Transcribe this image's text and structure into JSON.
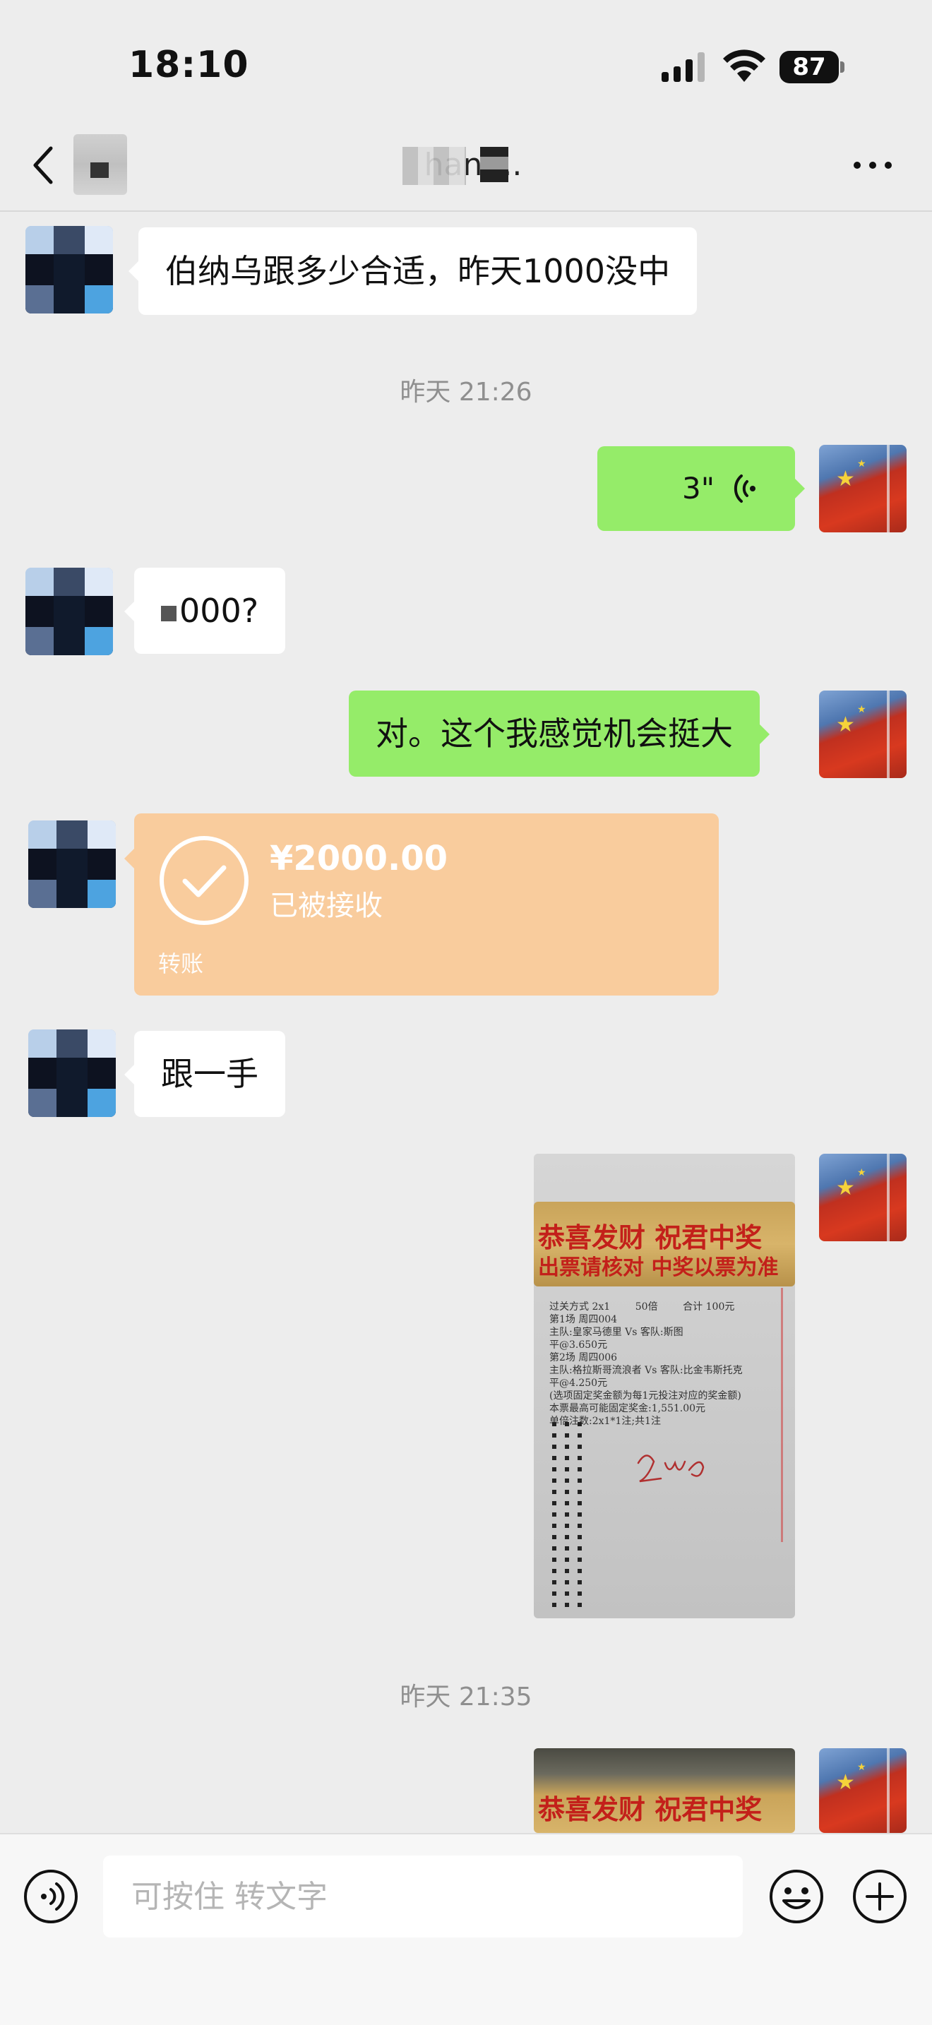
{
  "status_bar": {
    "time": "18:10",
    "battery": "87"
  },
  "nav": {
    "title": "hang..",
    "more_icon": "more-dots-icon",
    "back_icon": "chevron-left-icon"
  },
  "messages": {
    "m1": {
      "text": "伯纳乌跟多少合适，昨天1000没中"
    },
    "ts1": "昨天 21:26",
    "voice": {
      "duration": "3\""
    },
    "m2": {
      "text": "000?"
    },
    "m3": {
      "text": "对。这个我感觉机会挺大"
    },
    "transfer": {
      "amount": "¥2000.00",
      "status": "已被接收",
      "label": "转账"
    },
    "m4": {
      "text": "跟一手"
    },
    "ts2": "昨天 21:35",
    "photo1": {
      "line1": "恭喜发财 祝君中奖",
      "line2": "出票请核对 中奖以票为准",
      "detail": "过关方式 2x1        50倍        合计 100元\n第1场 周四004\n主队:皇家马德里 Vs 客队:斯图\n平@3.650元\n第2场 周四006\n主队:格拉斯哥流浪者 Vs 客队:比金韦斯托克\n平@4.250元\n(选项固定奖金额为每1元投注对应的奖金额)\n本票最高可能固定奖金:1,551.00元\n单倍注数:2x1*1注;共1注"
    },
    "photo2": {
      "line1": "恭喜发财 祝君中奖"
    }
  },
  "input": {
    "placeholder": "可按住 转文字"
  },
  "colors": {
    "bubble_green": "#95ec69",
    "transfer_orange": "#f9cc9d",
    "background": "#ededed"
  }
}
